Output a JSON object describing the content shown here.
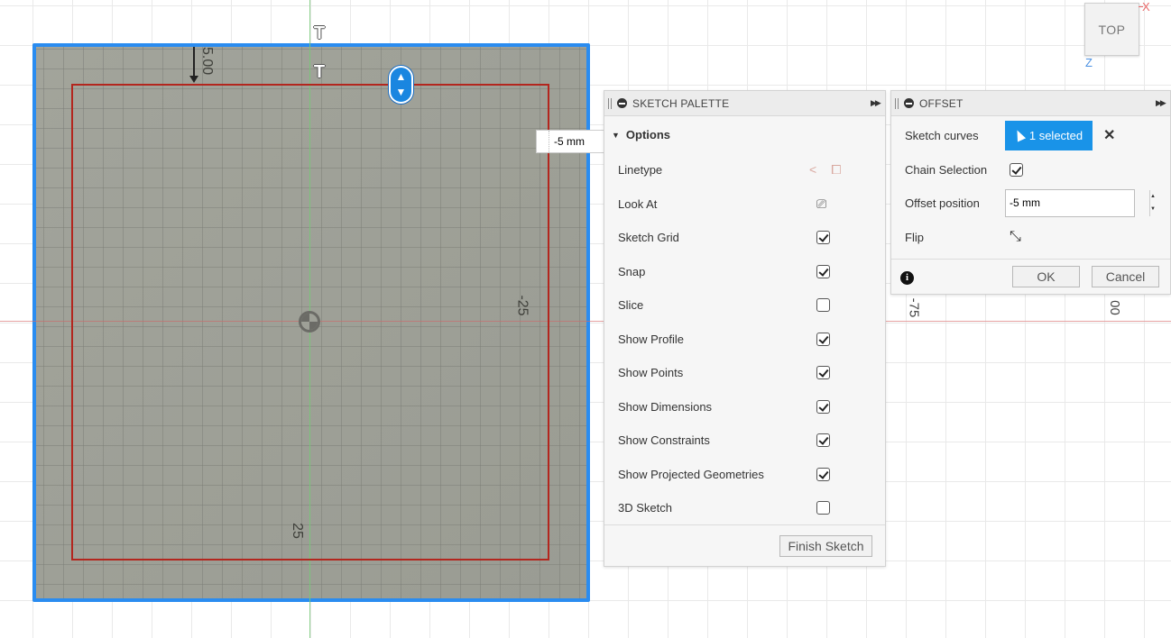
{
  "viewcube": {
    "label": "TOP",
    "x_axis": "X",
    "z_axis": "Z"
  },
  "canvas": {
    "dim_top": "5.00",
    "dim_right": "-25",
    "dim_bottom": "25",
    "ruler_1": "-75",
    "ruler_2": "00",
    "float_offset_value": "-5 mm"
  },
  "sketch_palette": {
    "title": "SKETCH PALETTE",
    "options_heading": "Options",
    "rows": [
      {
        "label": "Linetype",
        "type": "icons"
      },
      {
        "label": "Look At",
        "type": "icon"
      },
      {
        "label": "Sketch Grid",
        "checked": true
      },
      {
        "label": "Snap",
        "checked": true
      },
      {
        "label": "Slice",
        "checked": false
      },
      {
        "label": "Show Profile",
        "checked": true
      },
      {
        "label": "Show Points",
        "checked": true
      },
      {
        "label": "Show Dimensions",
        "checked": true
      },
      {
        "label": "Show Constraints",
        "checked": true
      },
      {
        "label": "Show Projected Geometries",
        "checked": true
      },
      {
        "label": "3D Sketch",
        "checked": false
      }
    ],
    "finish_label": "Finish Sketch"
  },
  "offset": {
    "title": "OFFSET",
    "sketch_curves_label": "Sketch curves",
    "selected_label": "1 selected",
    "chain_selection_label": "Chain Selection",
    "chain_selection_checked": true,
    "offset_position_label": "Offset position",
    "offset_position_value": "-5 mm",
    "flip_label": "Flip",
    "ok_label": "OK",
    "cancel_label": "Cancel"
  }
}
